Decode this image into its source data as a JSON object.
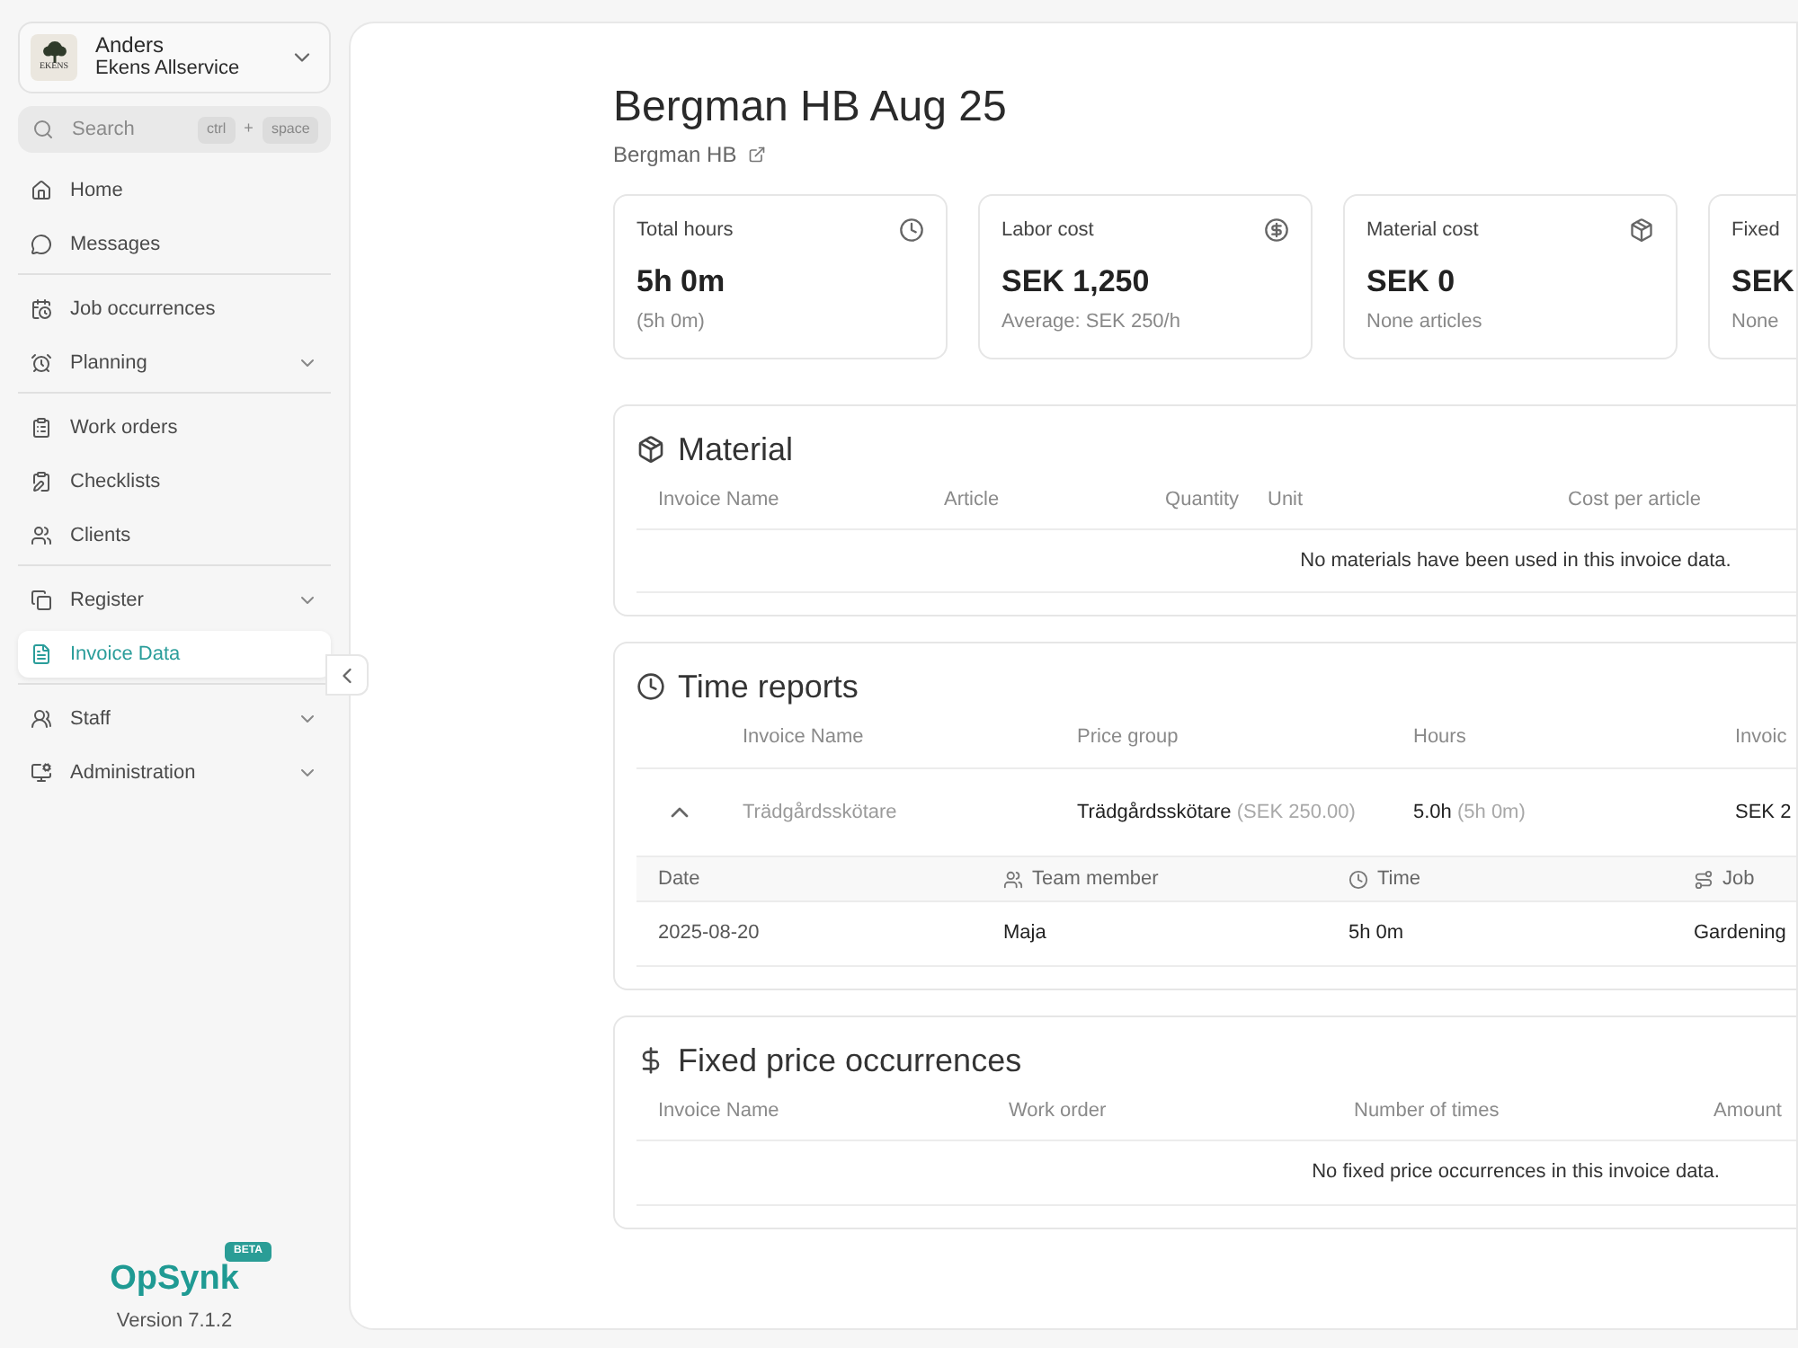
{
  "sidebar": {
    "account": {
      "user": "Anders",
      "company": "Ekens Allservice",
      "logo_text": "EKENS",
      "expanded": false
    },
    "search": {
      "placeholder": "Search",
      "shortcut": [
        "ctrl",
        "+",
        "space"
      ]
    },
    "sections": [
      {
        "items": [
          {
            "label": "Home",
            "kind": "link",
            "selected": false
          },
          {
            "label": "Messages",
            "kind": "link",
            "selected": false
          }
        ]
      },
      {
        "items": [
          {
            "label": "Job occurrences",
            "kind": "link",
            "selected": false
          },
          {
            "label": "Planning",
            "kind": "group",
            "selected": false,
            "expanded": false
          }
        ]
      },
      {
        "items": [
          {
            "label": "Work orders",
            "kind": "link",
            "selected": false
          },
          {
            "label": "Checklists",
            "kind": "link",
            "selected": false
          },
          {
            "label": "Clients",
            "kind": "link",
            "selected": false
          }
        ]
      },
      {
        "items": [
          {
            "label": "Register",
            "kind": "group",
            "selected": false,
            "expanded": false
          },
          {
            "label": "Invoice Data",
            "kind": "link",
            "selected": true
          }
        ]
      },
      {
        "items": [
          {
            "label": "Staff",
            "kind": "group",
            "selected": false,
            "expanded": false
          },
          {
            "label": "Administration",
            "kind": "group",
            "selected": false,
            "expanded": false
          }
        ]
      }
    ],
    "brand": {
      "name": "OpSynk",
      "badge": "BETA",
      "version": "Version 7.1.2"
    }
  },
  "page": {
    "title": "Bergman HB Aug 25",
    "client_link": "Bergman HB"
  },
  "stats": [
    {
      "label": "Total hours",
      "value": "5h 0m",
      "detail": "(5h 0m)"
    },
    {
      "label": "Labor cost",
      "value": "SEK 1,250",
      "detail": "Average: SEK 250/h"
    },
    {
      "label": "Material cost",
      "value": "SEK 0",
      "detail": "None articles"
    },
    {
      "label": "Fixed",
      "value": "SEK",
      "detail": "None"
    }
  ],
  "material": {
    "title": "Material",
    "columns": [
      "Invoice Name",
      "Article",
      "Quantity",
      "Unit",
      "Cost per article"
    ],
    "empty_message": "No materials have been used in this invoice data."
  },
  "time_reports": {
    "title": "Time reports",
    "columns": [
      "Invoice Name",
      "Price group",
      "Hours",
      "Invoic"
    ],
    "rows": [
      {
        "expanded": true,
        "invoice_name": "Trädgårdsskötare",
        "price_group": "Trädgårdsskötare",
        "rate": "(SEK 250.00)",
        "hours": "5.0h",
        "duration": "(5h 0m)",
        "amount": "SEK 2",
        "details": {
          "columns": [
            "Date",
            "Team member",
            "Time",
            "Job"
          ],
          "rows": [
            [
              "2025-08-20",
              "Maja",
              "5h 0m",
              "Gardening"
            ]
          ]
        }
      }
    ]
  },
  "fixed_price": {
    "title": "Fixed price occurrences",
    "columns": [
      "Invoice Name",
      "Work order",
      "Number of times",
      "Amount"
    ],
    "empty_message": "No fixed price occurrences in this invoice data."
  }
}
